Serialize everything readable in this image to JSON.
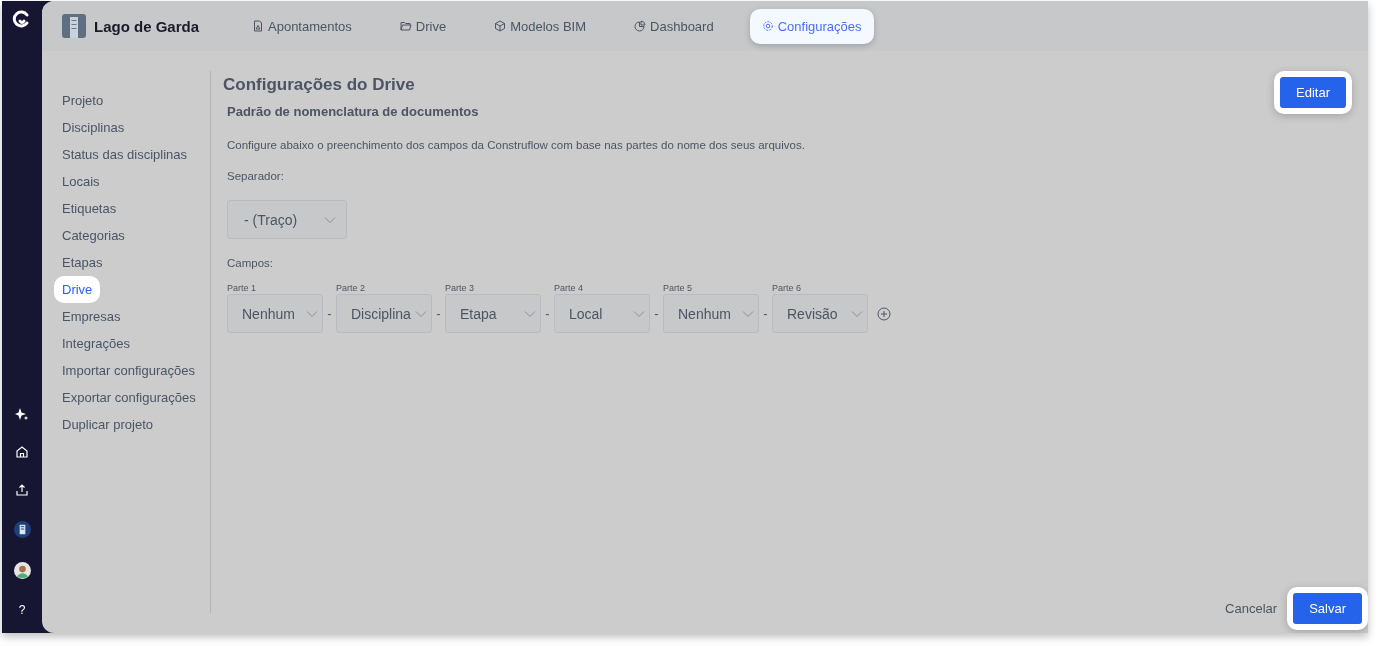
{
  "rail": {
    "help": "?"
  },
  "header": {
    "project": "Lago de Garda",
    "tabs": [
      {
        "label": "Apontamentos",
        "selected": false
      },
      {
        "label": "Drive",
        "selected": false
      },
      {
        "label": "Modelos BIM",
        "selected": false
      },
      {
        "label": "Dashboard",
        "selected": false
      },
      {
        "label": "Configurações",
        "selected": true
      }
    ]
  },
  "nav": {
    "items": [
      {
        "label": "Projeto",
        "selected": false
      },
      {
        "label": "Disciplinas",
        "selected": false
      },
      {
        "label": "Status das disciplinas",
        "selected": false
      },
      {
        "label": "Locais",
        "selected": false
      },
      {
        "label": "Etiquetas",
        "selected": false
      },
      {
        "label": "Categorias",
        "selected": false
      },
      {
        "label": "Etapas",
        "selected": false
      },
      {
        "label": "Drive",
        "selected": true
      },
      {
        "label": "Empresas",
        "selected": false
      },
      {
        "label": "Integrações",
        "selected": false
      },
      {
        "label": "Importar configurações",
        "selected": false
      },
      {
        "label": "Exportar configurações",
        "selected": false
      },
      {
        "label": "Duplicar projeto",
        "selected": false
      }
    ]
  },
  "content": {
    "title": "Configurações do Drive",
    "edit_button": {
      "label": "Editar",
      "highlighted": true
    },
    "section_title": "Padrão de nomenclatura de documentos",
    "description": "Configure abaixo o preenchimento dos campos da Construflow com base nas partes do nome dos seus arquivos.",
    "separator_label": "Separador:",
    "separator_value": "- (Traço)",
    "fields_label": "Campos:",
    "fields": [
      {
        "label": "Parte 1",
        "value": "Nenhum"
      },
      {
        "label": "Parte 2",
        "value": "Disciplina"
      },
      {
        "label": "Parte 3",
        "value": "Etapa"
      },
      {
        "label": "Parte 4",
        "value": "Local"
      },
      {
        "label": "Parte 5",
        "value": "Nenhum"
      },
      {
        "label": "Parte 6",
        "value": "Revisão"
      }
    ],
    "joiner": "-"
  },
  "footer": {
    "cancel": {
      "label": "Cancelar"
    },
    "save": {
      "label": "Salvar",
      "highlighted": true
    }
  }
}
